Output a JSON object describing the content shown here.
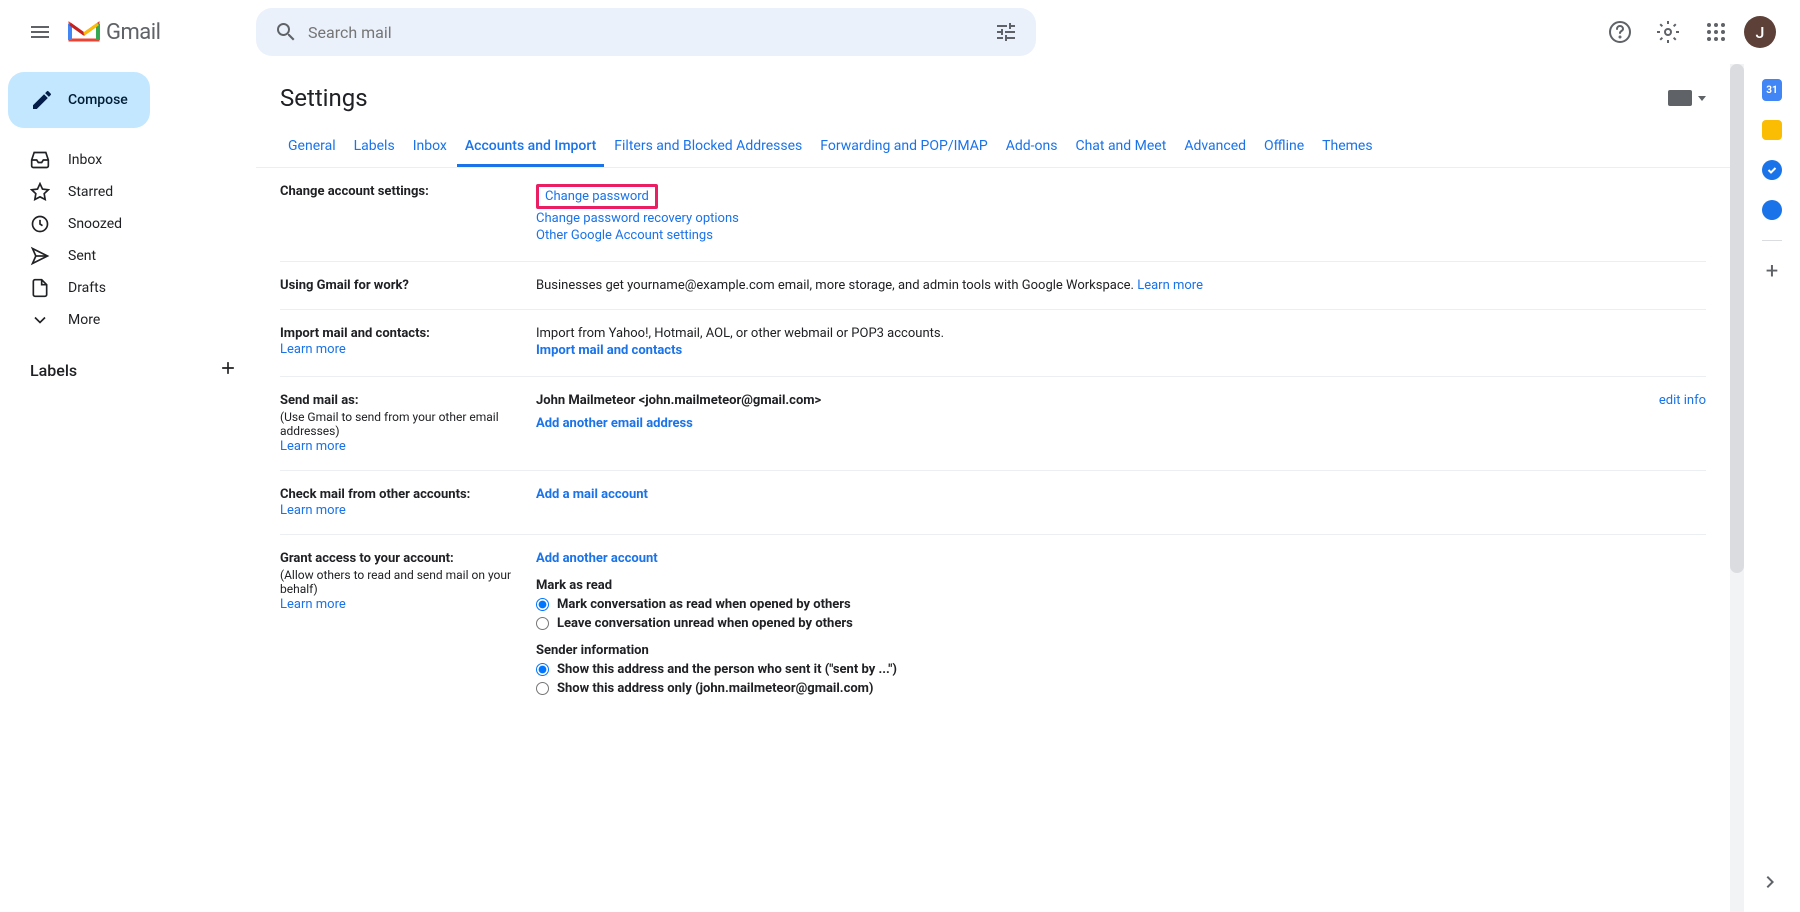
{
  "header": {
    "logoText": "Gmail",
    "searchPlaceholder": "Search mail",
    "avatarLetter": "J"
  },
  "sidebar": {
    "composeLabel": "Compose",
    "items": [
      {
        "label": "Inbox"
      },
      {
        "label": "Starred"
      },
      {
        "label": "Snoozed"
      },
      {
        "label": "Sent"
      },
      {
        "label": "Drafts"
      },
      {
        "label": "More"
      }
    ],
    "labelsHeader": "Labels"
  },
  "settings": {
    "title": "Settings",
    "tabs": [
      "General",
      "Labels",
      "Inbox",
      "Accounts and Import",
      "Filters and Blocked Addresses",
      "Forwarding and POP/IMAP",
      "Add-ons",
      "Chat and Meet",
      "Advanced",
      "Offline",
      "Themes"
    ],
    "activeTab": 3,
    "rows": {
      "changeAccount": {
        "label": "Change account settings:",
        "links": {
          "changePassword": "Change password",
          "recovery": "Change password recovery options",
          "other": "Other Google Account settings"
        }
      },
      "usingForWork": {
        "label": "Using Gmail for work?",
        "text": "Businesses get yourname@example.com email, more storage, and admin tools with Google Workspace. ",
        "learnMore": "Learn more"
      },
      "importMail": {
        "label": "Import mail and contacts:",
        "learnMore": "Learn more",
        "desc": "Import from Yahoo!, Hotmail, AOL, or other webmail or POP3 accounts.",
        "action": "Import mail and contacts"
      },
      "sendMailAs": {
        "label": "Send mail as:",
        "desc": "(Use Gmail to send from your other email addresses)",
        "learnMore": "Learn more",
        "identity": "John Mailmeteor <john.mailmeteor@gmail.com>",
        "editInfo": "edit info",
        "addAnother": "Add another email address"
      },
      "checkMail": {
        "label": "Check mail from other accounts:",
        "learnMore": "Learn more",
        "action": "Add a mail account"
      },
      "grantAccess": {
        "label": "Grant access to your account:",
        "desc": "(Allow others to read and send mail on your behalf)",
        "learnMore": "Learn more",
        "addAnother": "Add another account",
        "markAsRead": {
          "heading": "Mark as read",
          "opt1": "Mark conversation as read when opened by others",
          "opt2": "Leave conversation unread when opened by others"
        },
        "senderInfo": {
          "heading": "Sender information",
          "opt1": "Show this address and the person who sent it (\"sent by ...\")",
          "opt2": "Show this address only (john.mailmeteor@gmail.com)"
        }
      }
    }
  },
  "rightPanel": {
    "calendarDay": "31"
  }
}
